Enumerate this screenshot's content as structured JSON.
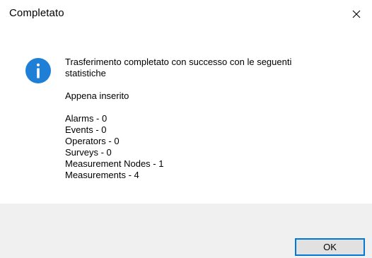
{
  "window": {
    "title": "Completato",
    "close_icon": "close-icon"
  },
  "dialog": {
    "icon": "info-icon",
    "icon_color": "#1f7fd6",
    "message": "Trasferimento completato con successo con le seguenti\nstatistiche\n\n Appena inserito\n\n Alarms - 0\n Events - 0\n Operators - 0\n Surveys - 0\n Measurement Nodes - 1\n Measurements - 4"
  },
  "footer": {
    "ok_label": "OK",
    "ok_border_color": "#0078d7"
  }
}
